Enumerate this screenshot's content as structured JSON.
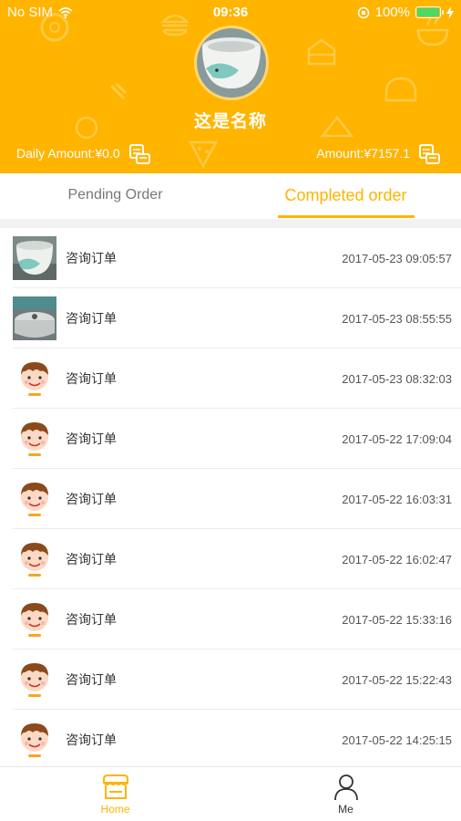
{
  "status_bar": {
    "carrier": "No SIM",
    "time": "09:36",
    "battery": "100%",
    "battery_level": 1.0
  },
  "header": {
    "store_name": "这是名称",
    "daily_amount": "Daily Amount:¥0.0",
    "amount": "Amount:¥7157.1",
    "background_color": "#ffb400"
  },
  "tabs": {
    "pending": "Pending Order",
    "completed": "Completed order",
    "active": "completed",
    "accent_color": "#ffb400"
  },
  "orders": [
    {
      "title": "咨询订单",
      "time": "2017-05-23 09:05:57",
      "avatar": "cup-photo"
    },
    {
      "title": "咨询订单",
      "time": "2017-05-23 08:55:55",
      "avatar": "pot-photo"
    },
    {
      "title": "咨询订单",
      "time": "2017-05-23 08:32:03",
      "avatar": "cartoon-face"
    },
    {
      "title": "咨询订单",
      "time": "2017-05-22 17:09:04",
      "avatar": "cartoon-face"
    },
    {
      "title": "咨询订单",
      "time": "2017-05-22 16:03:31",
      "avatar": "cartoon-face"
    },
    {
      "title": "咨询订单",
      "time": "2017-05-22 16:02:47",
      "avatar": "cartoon-face"
    },
    {
      "title": "咨询订单",
      "time": "2017-05-22 15:33:16",
      "avatar": "cartoon-face"
    },
    {
      "title": "咨询订单",
      "time": "2017-05-22 15:22:43",
      "avatar": "cartoon-face"
    },
    {
      "title": "咨询订单",
      "time": "2017-05-22 14:25:15",
      "avatar": "cartoon-face"
    }
  ],
  "tabbar": {
    "home": "Home",
    "me": "Me"
  }
}
